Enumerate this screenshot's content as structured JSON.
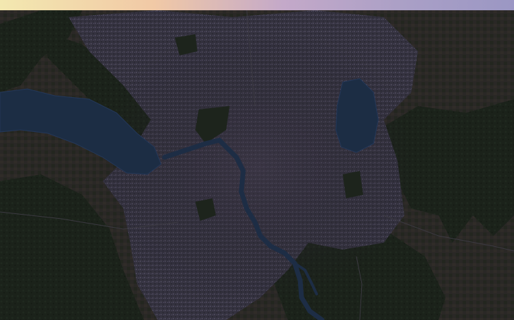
{
  "map": {
    "style": "satellite-night",
    "features": [
      "city",
      "lake-west",
      "lake-northeast",
      "river",
      "forest-east",
      "forest-southwest"
    ]
  },
  "colors": {
    "top_bar_start": "#f3e8b0",
    "top_bar_end": "#9b97c4",
    "city": "#3a3746",
    "water": "#1c2d44",
    "forest": "#1a2119",
    "background": "#1c1b22"
  }
}
